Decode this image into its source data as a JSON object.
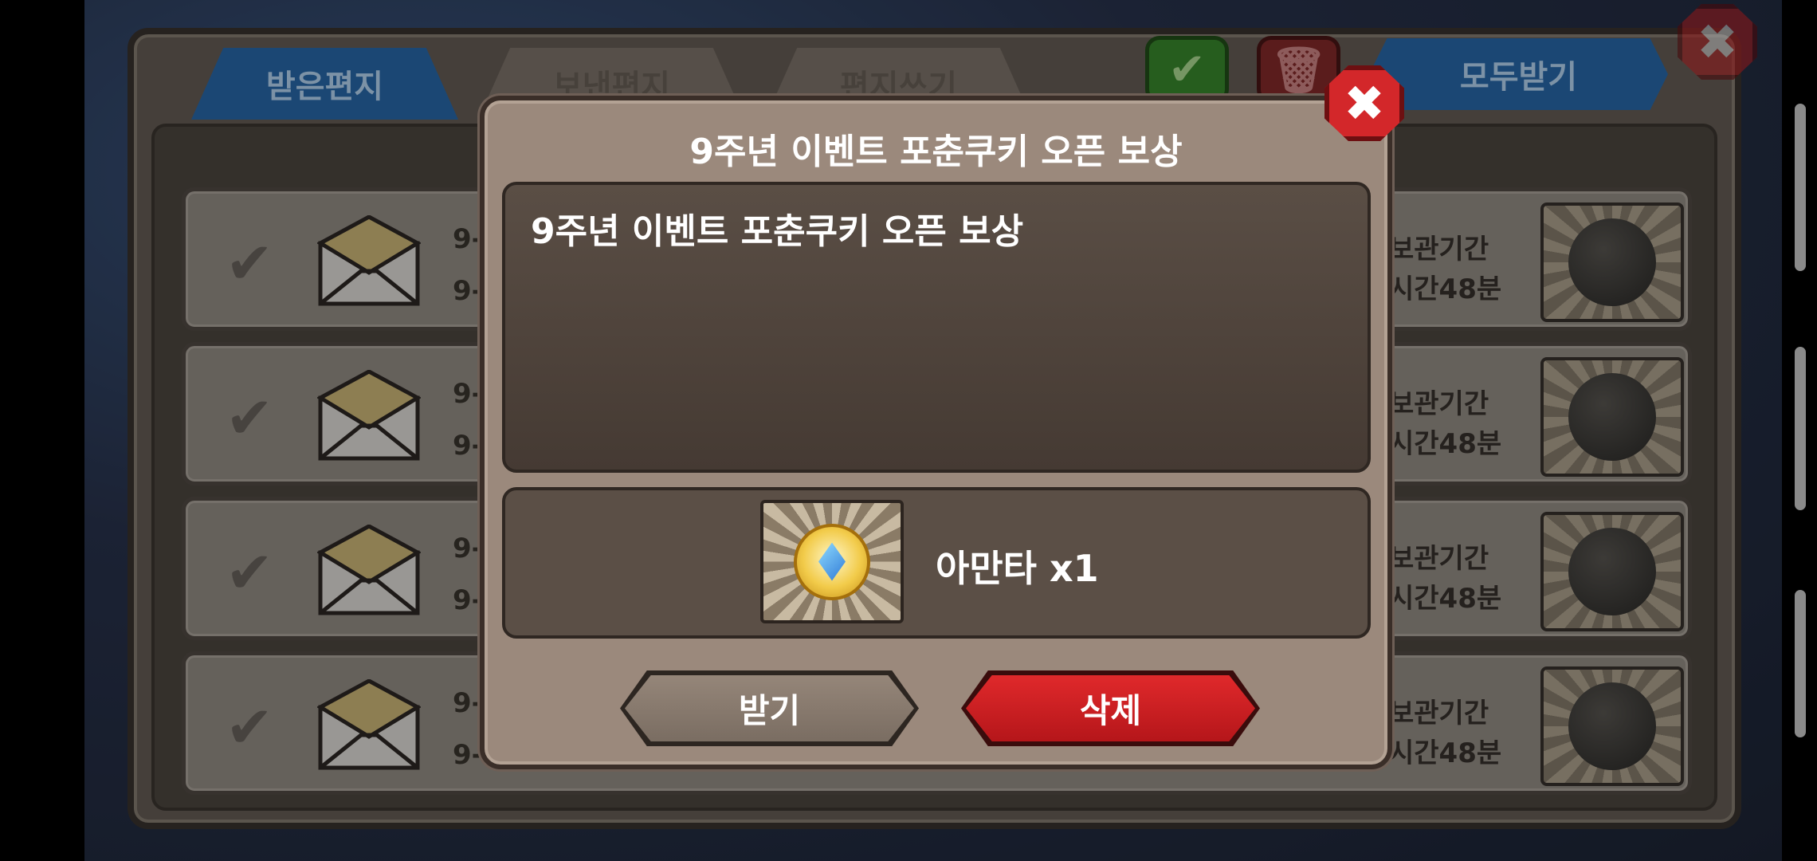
{
  "tabs": {
    "received": "받은편지",
    "sent": "보낸편지",
    "write": "편지쓰기"
  },
  "toolbar": {
    "receive_all": "모두받기"
  },
  "rows": [
    {
      "date1": "9-",
      "date2": "9-",
      "keep1": "보관기간",
      "keep2": "시간48분"
    },
    {
      "date1": "9-",
      "date2": "9-",
      "keep1": "보관기간",
      "keep2": "시간48분"
    },
    {
      "date1": "9-",
      "date2": "9-",
      "keep1": "보관기간",
      "keep2": "시간48분"
    },
    {
      "date1": "9-",
      "date2": "9-",
      "keep1": "보관기간",
      "keep2": "시간48분"
    }
  ],
  "dialog": {
    "title": "9주년 이벤트 포춘쿠키 오픈 보상",
    "message": "9주년 이벤트 포춘쿠키 오픈 보상",
    "reward_text": "아만타 x1",
    "receive_label": "받기",
    "delete_label": "삭제"
  },
  "colors": {
    "accent_blue": "#2a6db3",
    "delete_red": "#d3272a",
    "panel_brown": "#9b897c"
  }
}
